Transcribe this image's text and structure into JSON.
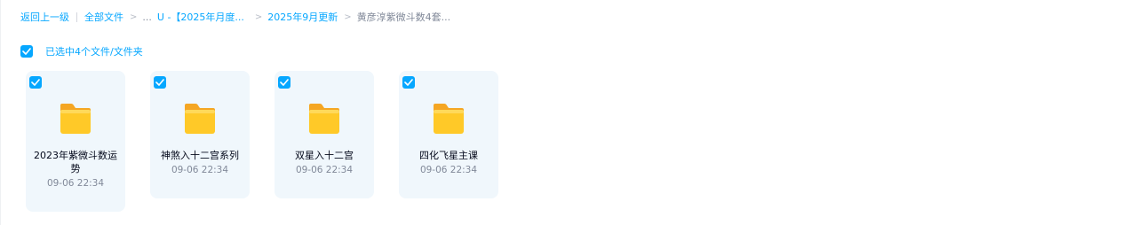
{
  "breadcrumb": {
    "back": "返回上一级",
    "all_files": "全部文件",
    "sep": ">",
    "ellipsis": "...",
    "crumb_1": "U -【2025年月度...",
    "crumb_2": "2025年9月更新",
    "current": "黄彦淳紫微斗数4套..."
  },
  "selection": {
    "label": "已选中4个文件/文件夹",
    "checked": true
  },
  "files": [
    {
      "name": "2023年紫微斗数运势",
      "time": "09-06 22:34",
      "type": "folder",
      "checked": true
    },
    {
      "name": "神煞入十二宫系列",
      "time": "09-06 22:34",
      "type": "folder",
      "checked": true
    },
    {
      "name": "双星入十二宫",
      "time": "09-06 22:34",
      "type": "folder",
      "checked": true
    },
    {
      "name": "四化飞星主课",
      "time": "09-06 22:34",
      "type": "folder",
      "checked": true
    }
  ],
  "colors": {
    "accent": "#06a7ff",
    "card_bg": "#f0f7fc",
    "folder_yellow": "#ffc928",
    "text_primary": "#03081a",
    "text_secondary": "#818999"
  },
  "icons": {
    "checkbox": "checkmark-icon",
    "folder": "folder-icon"
  }
}
